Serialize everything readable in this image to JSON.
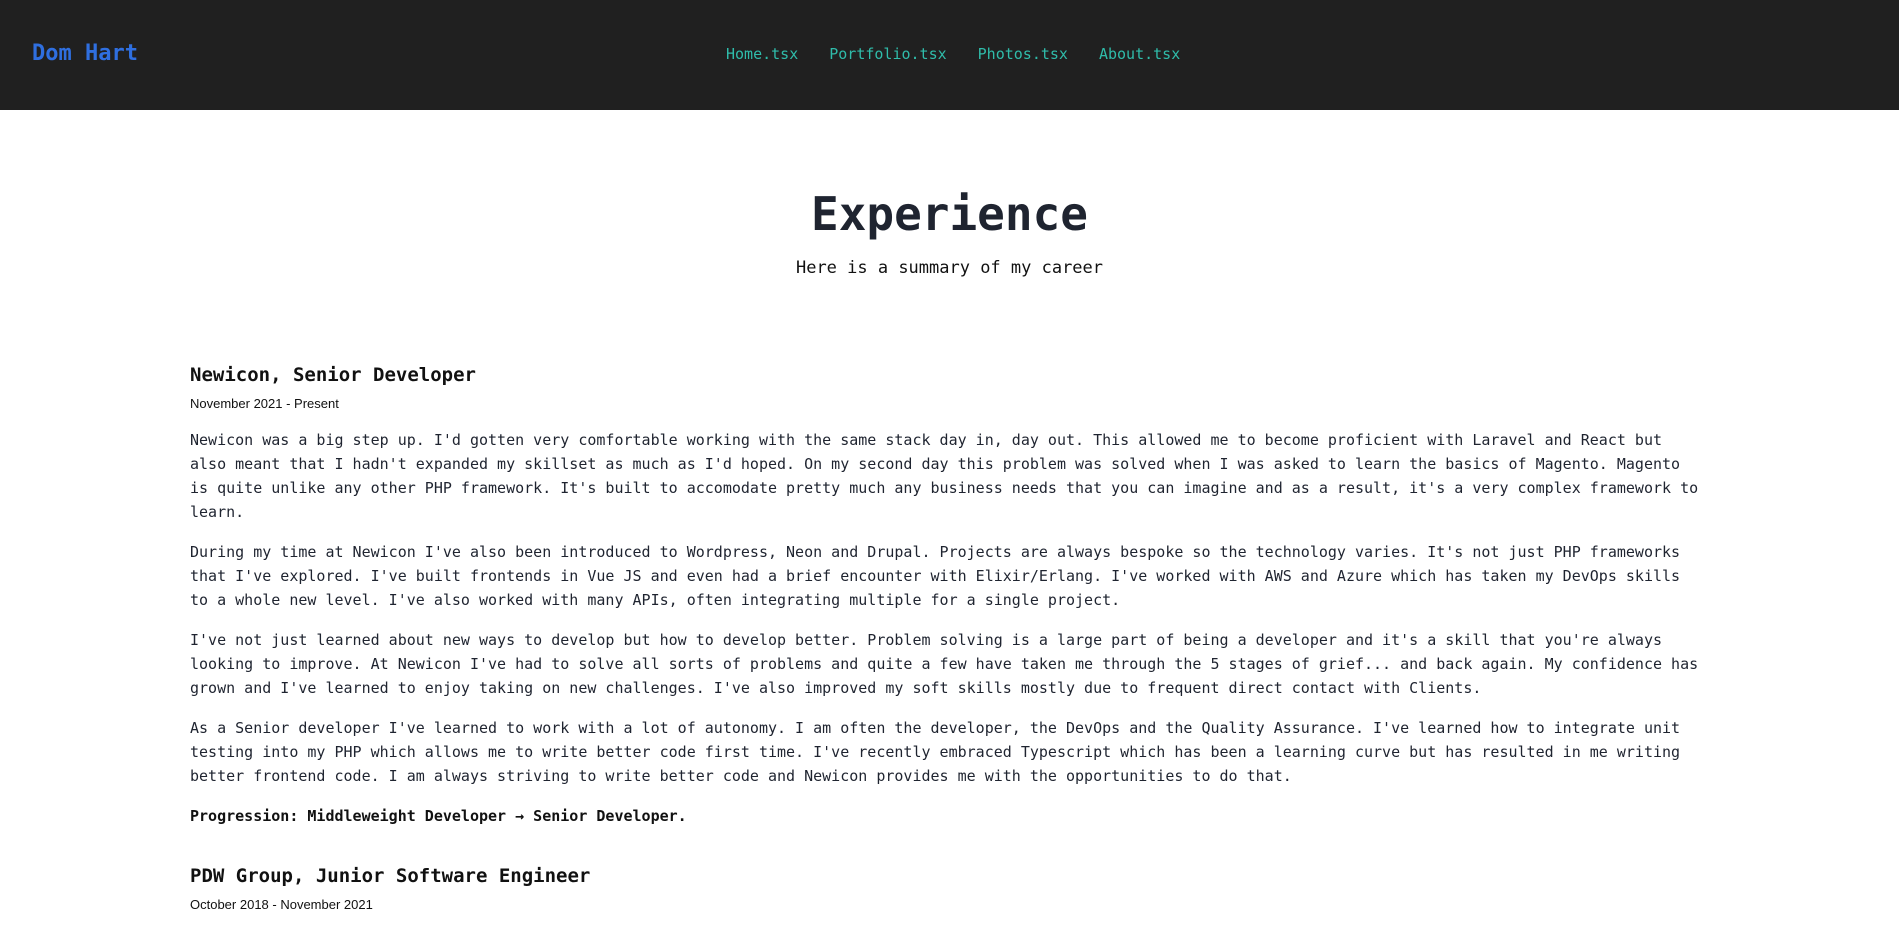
{
  "header": {
    "brand": "Dom Hart",
    "nav": [
      "Home.tsx",
      "Portfolio.tsx",
      "Photos.tsx",
      "About.tsx"
    ]
  },
  "hero": {
    "title": "Experience",
    "subtitle": "Here is a summary of my career"
  },
  "jobs": [
    {
      "title": "Newicon, Senior Developer",
      "dates": "November 2021 - Present",
      "paragraphs": [
        "Newicon was a big step up. I'd gotten very comfortable working with the same stack day in, day out. This allowed me to become proficient with Laravel and React but also meant that I hadn't expanded my skillset as much as I'd hoped. On my second day this problem was solved when I was asked to learn the basics of Magento. Magento is quite unlike any other PHP framework. It's built to accomodate pretty much any business needs that you can imagine and as a result, it's a very complex framework to learn.",
        "During my time at Newicon I've also been introduced to Wordpress, Neon and Drupal. Projects are always bespoke so the technology varies. It's not just PHP frameworks that I've explored. I've built frontends in Vue JS and even had a brief encounter with Elixir/Erlang. I've worked with AWS and Azure which has taken my DevOps skills to a whole new level. I've also worked with many APIs, often integrating multiple for a single project.",
        "I've not just learned about new ways to develop but how to develop better. Problem solving is a large part of being a developer and it's a skill that you're always looking to improve. At Newicon I've had to solve all sorts of problems and quite a few have taken me through the 5 stages of grief... and back again. My confidence has grown and I've learned to enjoy taking on new challenges. I've also improved my soft skills mostly due to frequent direct contact with Clients.",
        "As a Senior developer I've learned to work with a lot of autonomy. I am often the developer, the DevOps and the Quality Assurance. I've learned how to integrate unit testing into my PHP which allows me to write better code first time. I've recently embraced Typescript which has been a learning curve but has resulted in me writing better frontend code. I am always striving to write better code and Newicon provides me with the opportunities to do that."
      ],
      "progression": "Progression: Middleweight Developer → Senior Developer."
    },
    {
      "title": "PDW Group, Junior Software Engineer",
      "dates": "October 2018 - November 2021"
    }
  ]
}
